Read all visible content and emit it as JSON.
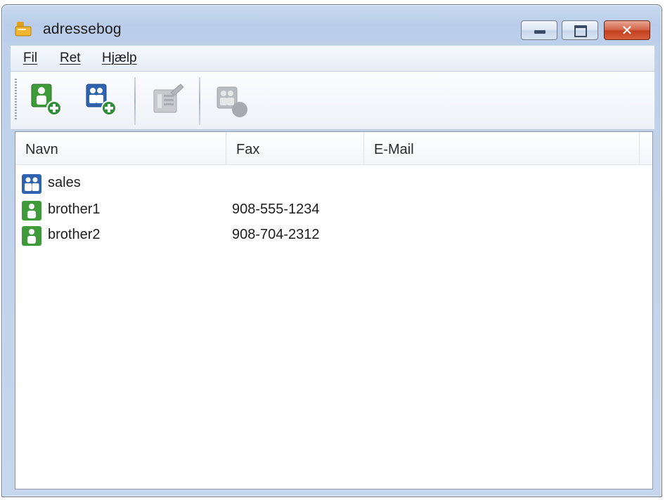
{
  "window": {
    "title": "adressebog",
    "icon": "address-book-icon",
    "controls": [
      "minimize-icon",
      "maximize-icon",
      "close-icon"
    ]
  },
  "menu": {
    "items": [
      "Fil",
      "Ret",
      "Hjælp"
    ]
  },
  "toolbar": {
    "buttons": [
      {
        "icon": "add-contact-icon",
        "enabled": true
      },
      {
        "icon": "add-group-icon",
        "enabled": true
      },
      {
        "icon": "edit-icon",
        "enabled": false
      },
      {
        "icon": "delete-icon",
        "enabled": false
      }
    ]
  },
  "list": {
    "columns": [
      "Navn",
      "Fax",
      "E-Mail"
    ],
    "rows": [
      {
        "type": "group",
        "icon": "group-icon",
        "name": "sales",
        "fax": "",
        "email": ""
      },
      {
        "type": "contact",
        "icon": "contact-icon",
        "name": "brother1",
        "fax": "908-555-1234",
        "email": ""
      },
      {
        "type": "contact",
        "icon": "contact-icon",
        "name": "brother2",
        "fax": "908-704-2312",
        "email": ""
      }
    ]
  },
  "colors": {
    "contact_green": "#3f9a3a",
    "group_blue": "#2f63b0",
    "add_badge_green": "#2e8f3a",
    "close_red": "#c8462a",
    "frame_blue": "#bfd1ea"
  }
}
